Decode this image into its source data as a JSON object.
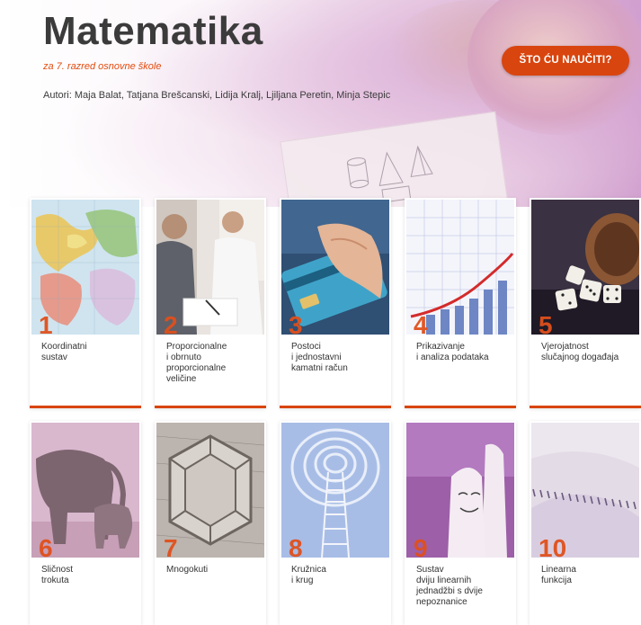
{
  "header": {
    "title": "Matematika",
    "subtitle": "za 7. razred osnovne škole",
    "authors": "Autori: Maja Balat, Tatjana Brešcanski, Lidija Kralj, Ljiljana Peretin, Minja Stepic",
    "button_label": "ŠTO ĆU NAUČITI?"
  },
  "colors": {
    "accent": "#d9450e",
    "number": "#e0501c",
    "title": "#3b3b3b"
  },
  "units": [
    {
      "number": "1",
      "title": "Koordinatni\nsustav",
      "icon": "world-map-image"
    },
    {
      "number": "2",
      "title": "Proporcionalne\ni obrnuto\nproporcionalne\nveličine",
      "icon": "business-people-image"
    },
    {
      "number": "3",
      "title": "Postoci\ni jednostavni\nkamatni račun",
      "icon": "credit-card-image"
    },
    {
      "number": "4",
      "title": "Prikazivanje\ni analiza podataka",
      "icon": "bar-chart-image"
    },
    {
      "number": "5",
      "title": "Vjerojatnost\nslučajnog događaja",
      "icon": "dice-image"
    },
    {
      "number": "6",
      "title": "Sličnost\ntrokuta",
      "icon": "elephants-image"
    },
    {
      "number": "7",
      "title": "Mnogokuti",
      "icon": "hexagon-wood-image"
    },
    {
      "number": "8",
      "title": "Kružnica\ni krug",
      "icon": "ladder-circles-image"
    },
    {
      "number": "9",
      "title": "Sustav\ndviju linearnih\njednadžbi s dvije\nnepoznanice",
      "icon": "finger-face-image"
    },
    {
      "number": "10",
      "title": "Linearna\nfunkcija",
      "icon": "linear-pattern-image"
    }
  ]
}
